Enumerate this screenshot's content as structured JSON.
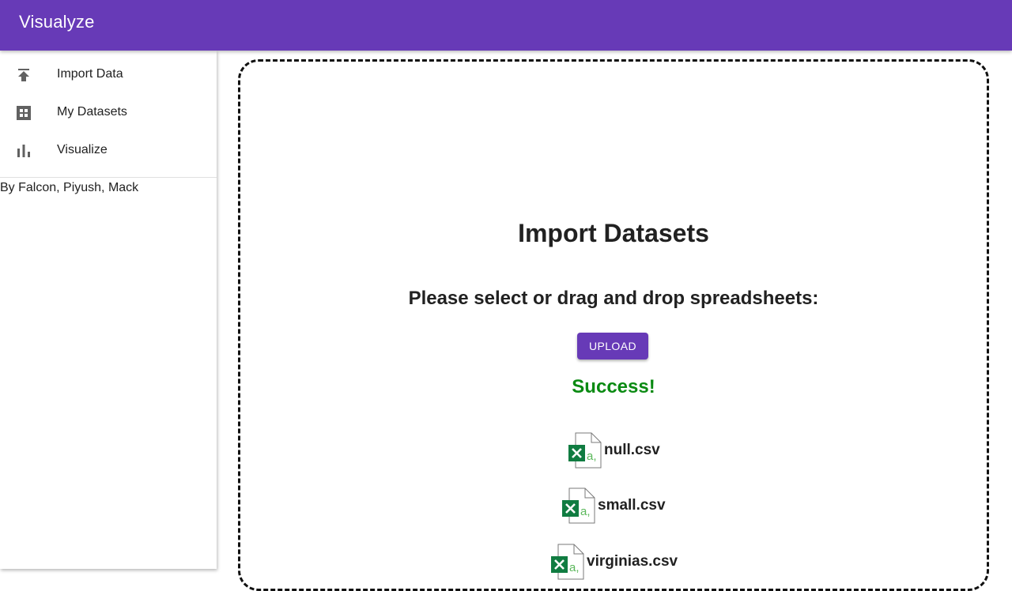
{
  "header": {
    "title": "Visualyze"
  },
  "sidebar": {
    "items": [
      {
        "label": "Import Data",
        "icon": "upload-icon"
      },
      {
        "label": "My Datasets",
        "icon": "dashboard-grid-icon"
      },
      {
        "label": "Visualize",
        "icon": "bar-chart-icon"
      }
    ],
    "credits": "By Falcon, Piyush, Mack"
  },
  "main": {
    "title": "Import Datasets",
    "prompt": "Please select or drag and drop spreadsheets:",
    "upload_label": "UPLOAD",
    "status": "Success!",
    "files": [
      {
        "name": "null.csv",
        "icon": "excel-csv-icon"
      },
      {
        "name": "small.csv",
        "icon": "excel-csv-icon"
      },
      {
        "name": "virginias.csv",
        "icon": "excel-csv-icon"
      }
    ]
  },
  "colors": {
    "primary": "#673ab7",
    "success": "#0a8a12",
    "excel_green": "#107c41",
    "icon_gray": "#616161"
  }
}
